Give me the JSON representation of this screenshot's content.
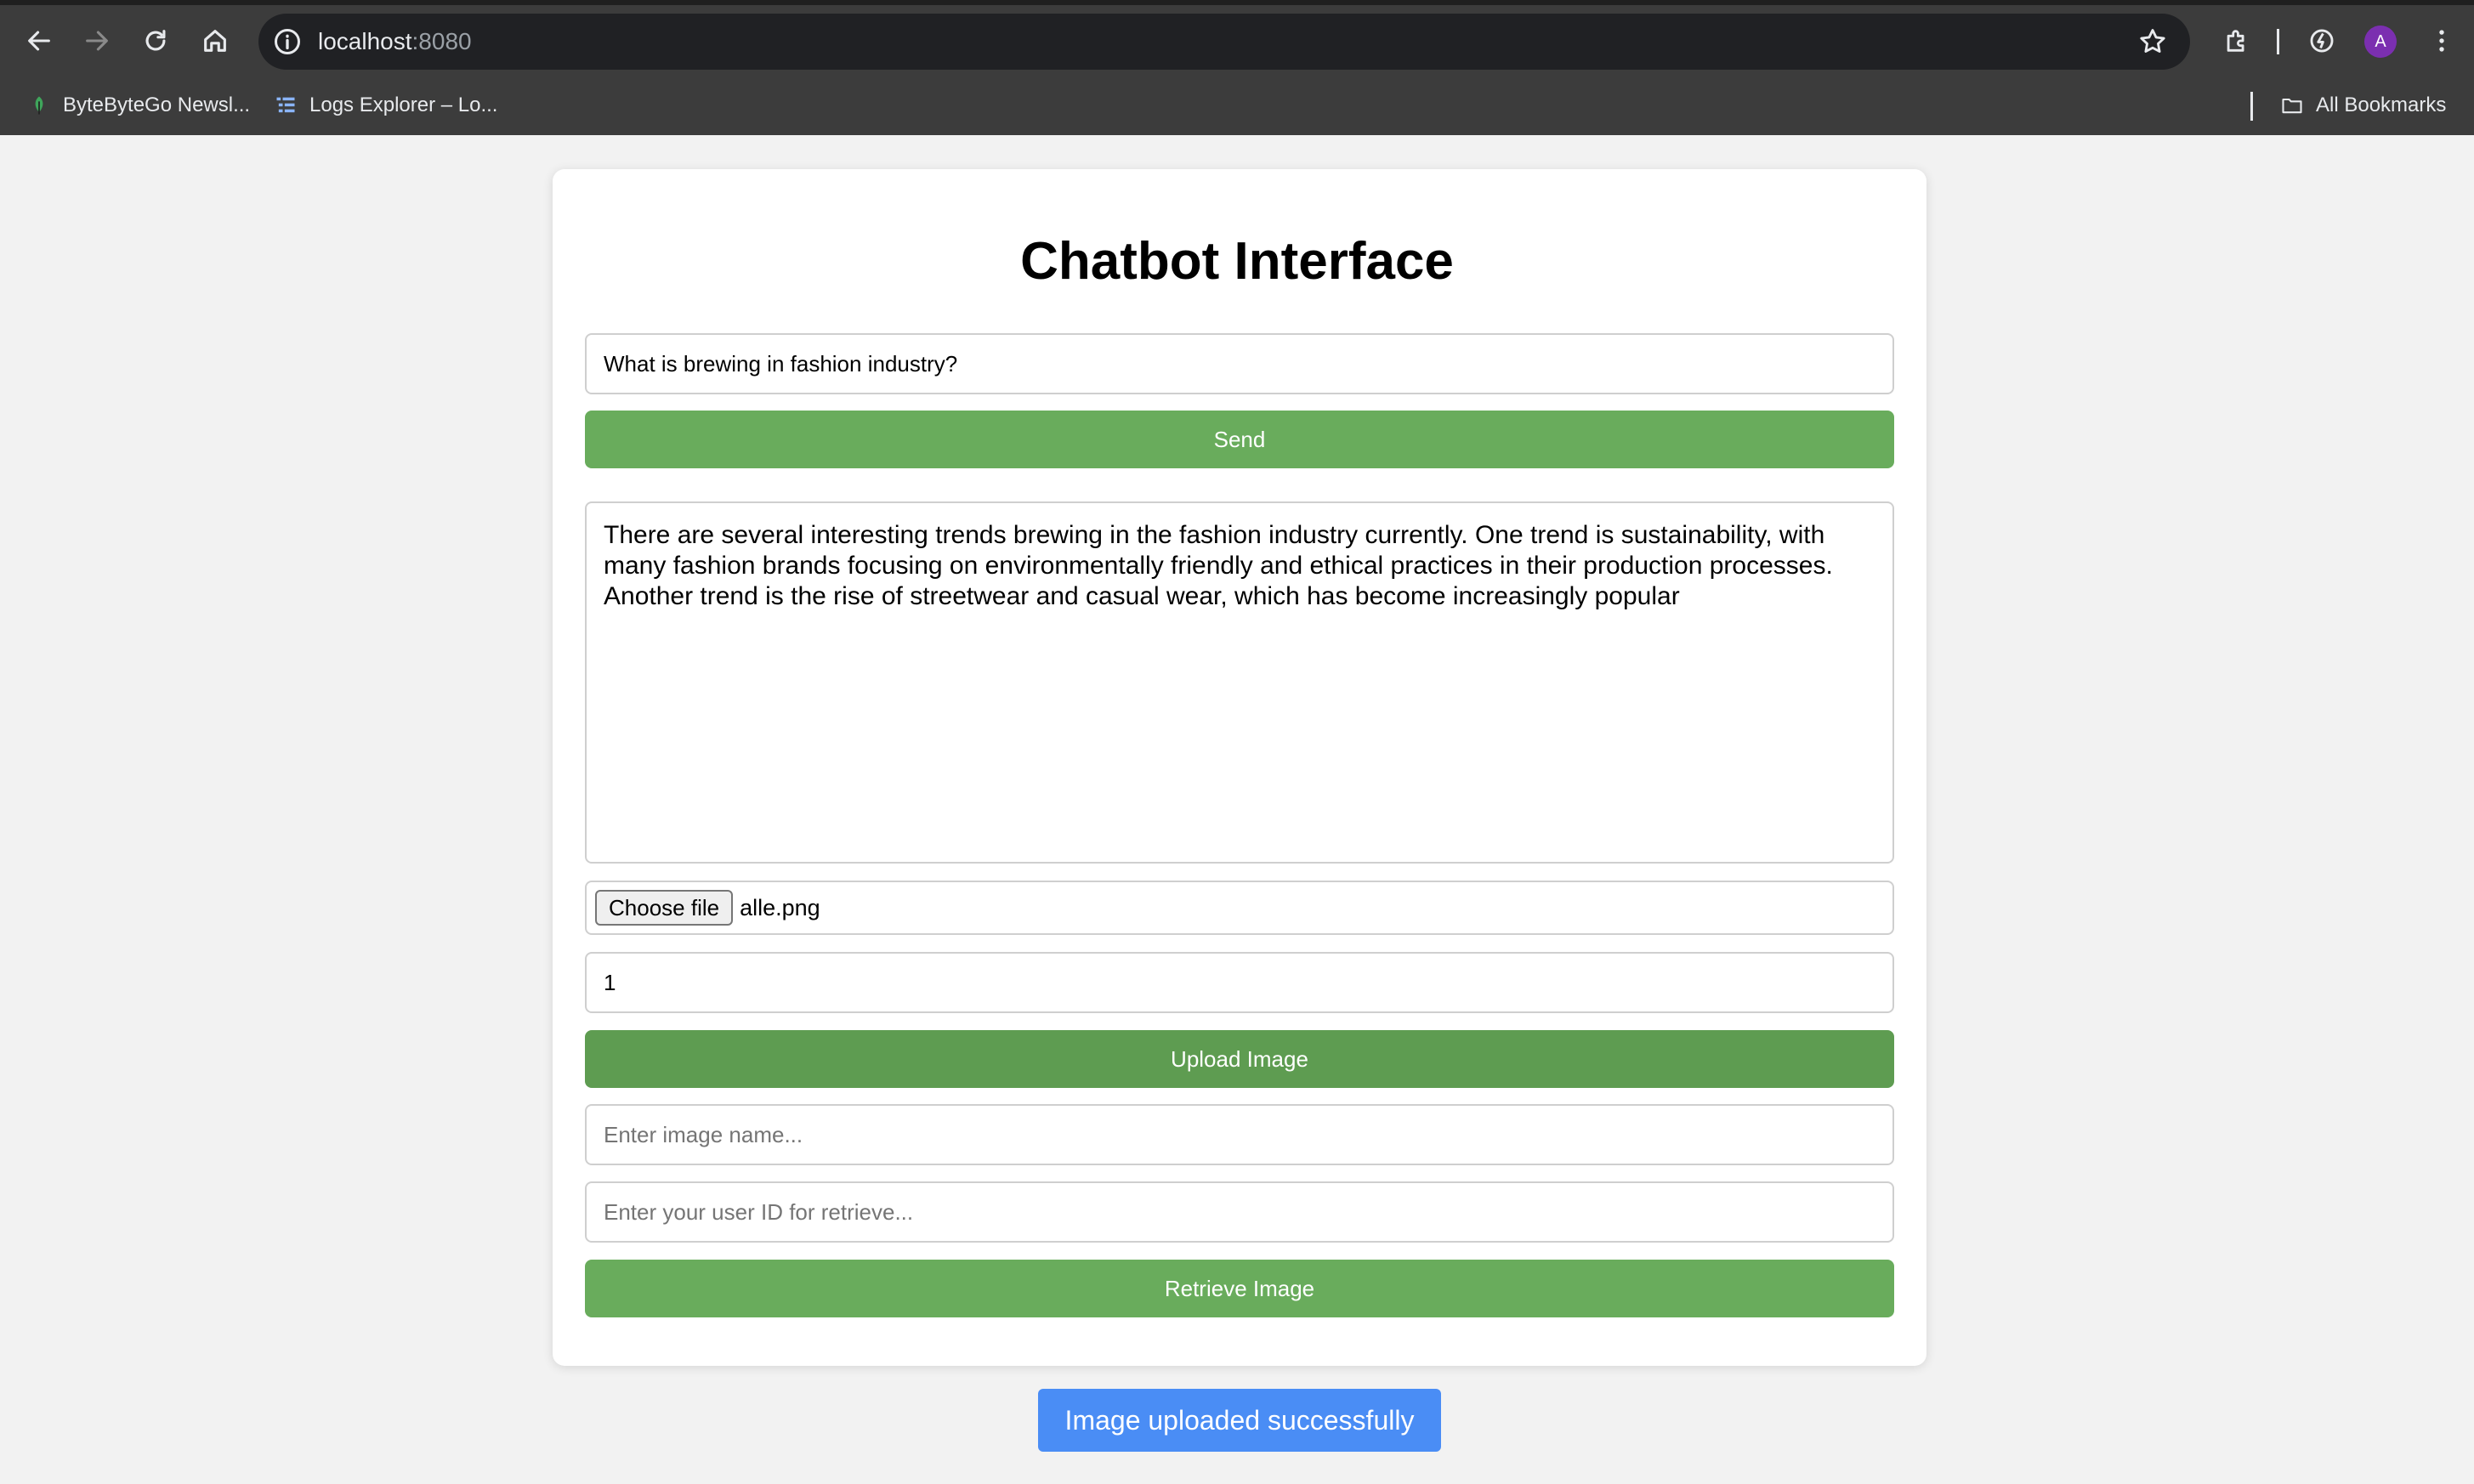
{
  "browser": {
    "url_host": "localhost",
    "url_port": ":8080",
    "avatar_letter": "A",
    "bookmarks": [
      {
        "label": "ByteByteGo Newsl...",
        "icon": "leaf-favicon-icon"
      },
      {
        "label": "Logs Explorer – Lo...",
        "icon": "logs-favicon-icon"
      }
    ],
    "all_bookmarks_label": "All Bookmarks"
  },
  "page": {
    "title": "Chatbot Interface",
    "query": {
      "value": "What is brewing in fashion industry?"
    },
    "send_label": "Send",
    "response_text": "There are several interesting trends brewing in the fashion industry currently. One trend is sustainability, with many fashion brands focusing on environmentally friendly and ethical practices in their production processes. Another trend is the rise of streetwear and casual wear, which has become increasingly popular",
    "file_input": {
      "button_label": "Choose file",
      "file_name": "alle.png"
    },
    "user_id": {
      "value": "1"
    },
    "upload_label": "Upload Image",
    "image_name": {
      "placeholder": "Enter image name..."
    },
    "retrieve_user_id": {
      "placeholder": "Enter your user ID for retrieve..."
    },
    "retrieve_label": "Retrieve Image",
    "toast": "Image uploaded successfully"
  },
  "colors": {
    "button_green": "#69ac5c",
    "button_green_hover": "#5e9c51",
    "toast_blue": "#4a8df5",
    "chrome_dark": "#3c3c3c"
  }
}
